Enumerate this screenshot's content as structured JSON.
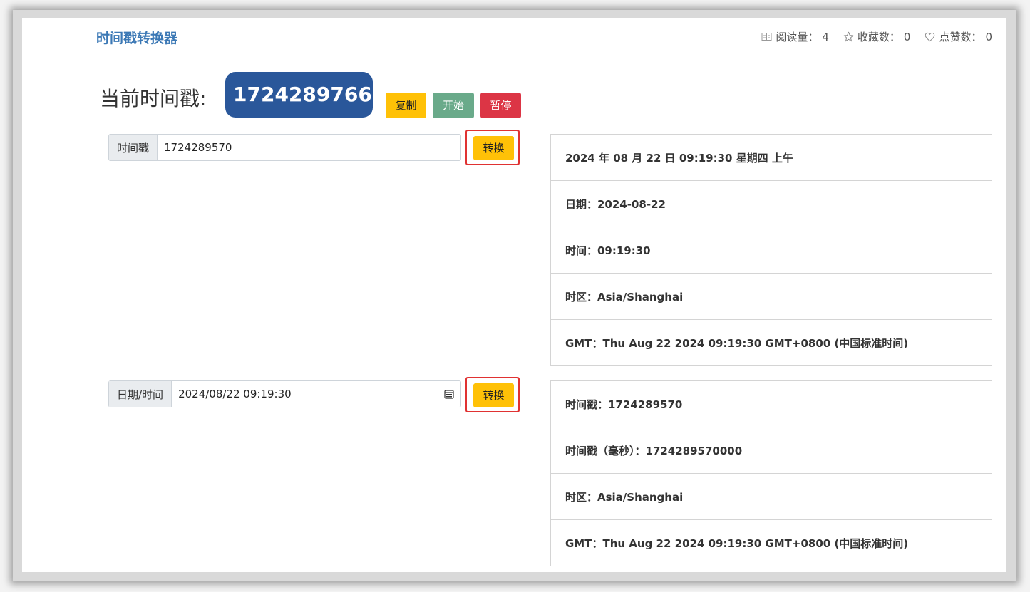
{
  "header": {
    "title": "时间戳转换器",
    "stats": [
      {
        "icon": "book-icon",
        "label": "阅读量：",
        "value": "4"
      },
      {
        "icon": "star-icon",
        "label": "收藏数：",
        "value": "0"
      },
      {
        "icon": "heart-icon",
        "label": "点赞数：",
        "value": "0"
      }
    ]
  },
  "current": {
    "label": "当前时间戳:",
    "value": "1724289766",
    "copy_label": "复制",
    "start_label": "开始",
    "pause_label": "暂停"
  },
  "timestamp_to_date": {
    "addon": "时间戳",
    "value": "1724289570",
    "convert_label": "转换",
    "results": [
      "2024 年 08 月 22 日 09:19:30 星期四 上午",
      "日期：2024-08-22",
      "时间：09:19:30",
      "时区：Asia/Shanghai",
      "GMT：Thu Aug 22 2024 09:19:30 GMT+0800 (中国标准时间)"
    ]
  },
  "date_to_timestamp": {
    "addon": "日期/时间",
    "value": "2024/08/22 09:19:30",
    "convert_label": "转换",
    "results": [
      "时间戳：1724289570",
      "时间戳（毫秒）：1724289570000",
      "时区：Asia/Shanghai",
      "GMT：Thu Aug 22 2024 09:19:30 GMT+0800 (中国标准时间)"
    ]
  },
  "colors": {
    "title": "#3b78b5",
    "current_bg": "#2a579a",
    "warning": "#ffc107",
    "success": "#6aaa8a",
    "danger": "#dc3545",
    "highlight_border": "#e03232"
  }
}
